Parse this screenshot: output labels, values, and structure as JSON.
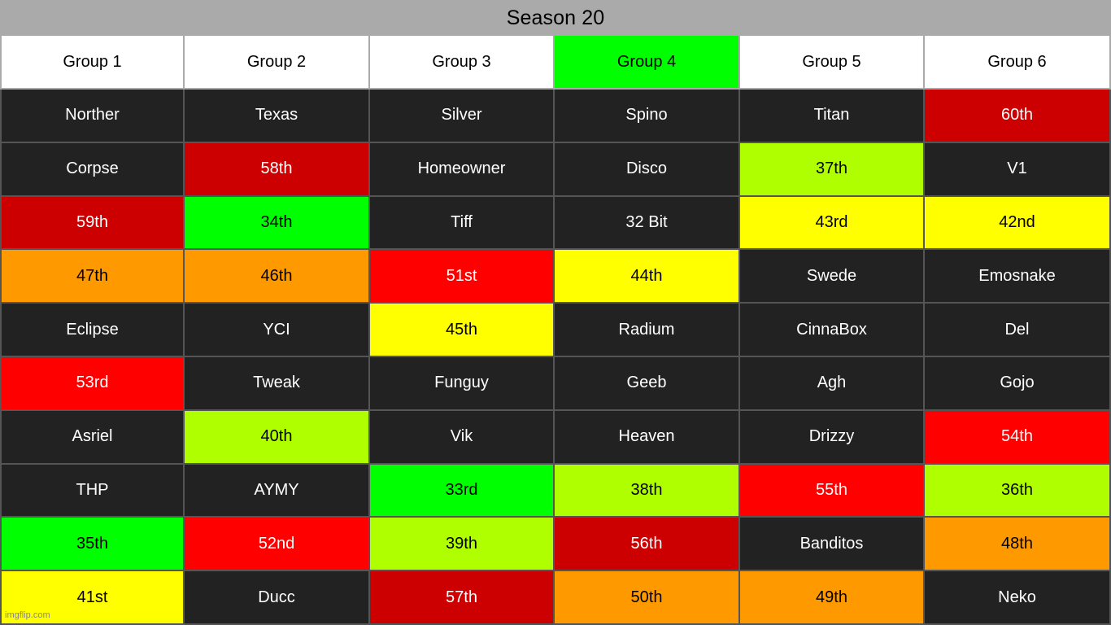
{
  "title": {
    "text": "Season 20",
    "bar_color": "#AAAAAA",
    "text_color": "#000000"
  },
  "watermark": {
    "text": "imgflip.com"
  },
  "palette": {
    "dark": "#222222",
    "green": "#00FF00",
    "lime": "#B0FF00",
    "yellow": "#FFFF00",
    "orange": "#FF9900",
    "red": "#FF0000",
    "darkred": "#CC0000",
    "white": "#FFFFFF",
    "border": "#555555",
    "header_border": "#AAAAAA"
  },
  "columns": [
    {
      "label": "Group 1",
      "state": "white"
    },
    {
      "label": "Group 2",
      "state": "white"
    },
    {
      "label": "Group 3",
      "state": "white"
    },
    {
      "label": "Group 4",
      "state": "green"
    },
    {
      "label": "Group 5",
      "state": "white"
    },
    {
      "label": "Group 6",
      "state": "white"
    }
  ],
  "rows": [
    [
      {
        "label": "Norther",
        "state": "dark"
      },
      {
        "label": "Texas",
        "state": "dark"
      },
      {
        "label": "Silver",
        "state": "dark"
      },
      {
        "label": "Spino",
        "state": "dark"
      },
      {
        "label": "Titan",
        "state": "dark"
      },
      {
        "label": "60th",
        "state": "darkred"
      }
    ],
    [
      {
        "label": "Corpse",
        "state": "dark"
      },
      {
        "label": "58th",
        "state": "darkred"
      },
      {
        "label": "Homeowner",
        "state": "dark"
      },
      {
        "label": "Disco",
        "state": "dark"
      },
      {
        "label": "37th",
        "state": "lime"
      },
      {
        "label": "V1",
        "state": "dark"
      }
    ],
    [
      {
        "label": "59th",
        "state": "darkred"
      },
      {
        "label": "34th",
        "state": "green"
      },
      {
        "label": "Tiff",
        "state": "dark"
      },
      {
        "label": "32 Bit",
        "state": "dark"
      },
      {
        "label": "43rd",
        "state": "yellow"
      },
      {
        "label": "42nd",
        "state": "yellow"
      }
    ],
    [
      {
        "label": "47th",
        "state": "orange"
      },
      {
        "label": "46th",
        "state": "orange"
      },
      {
        "label": "51st",
        "state": "red"
      },
      {
        "label": "44th",
        "state": "yellow"
      },
      {
        "label": "Swede",
        "state": "dark"
      },
      {
        "label": "Emosnake",
        "state": "dark"
      }
    ],
    [
      {
        "label": "Eclipse",
        "state": "dark"
      },
      {
        "label": "YCI",
        "state": "dark"
      },
      {
        "label": "45th",
        "state": "yellow"
      },
      {
        "label": "Radium",
        "state": "dark"
      },
      {
        "label": "CinnaBox",
        "state": "dark"
      },
      {
        "label": "Del",
        "state": "dark"
      }
    ],
    [
      {
        "label": "53rd",
        "state": "red"
      },
      {
        "label": "Tweak",
        "state": "dark"
      },
      {
        "label": "Funguy",
        "state": "dark"
      },
      {
        "label": "Geeb",
        "state": "dark"
      },
      {
        "label": "Agh",
        "state": "dark"
      },
      {
        "label": "Gojo",
        "state": "dark"
      }
    ],
    [
      {
        "label": "Asriel",
        "state": "dark"
      },
      {
        "label": "40th",
        "state": "lime"
      },
      {
        "label": "Vik",
        "state": "dark"
      },
      {
        "label": "Heaven",
        "state": "dark"
      },
      {
        "label": "Drizzy",
        "state": "dark"
      },
      {
        "label": "54th",
        "state": "red"
      }
    ],
    [
      {
        "label": "THP",
        "state": "dark"
      },
      {
        "label": "AYMY",
        "state": "dark"
      },
      {
        "label": "33rd",
        "state": "green"
      },
      {
        "label": "38th",
        "state": "lime"
      },
      {
        "label": "55th",
        "state": "red"
      },
      {
        "label": "36th",
        "state": "lime"
      }
    ],
    [
      {
        "label": "35th",
        "state": "green"
      },
      {
        "label": "52nd",
        "state": "red"
      },
      {
        "label": "39th",
        "state": "lime"
      },
      {
        "label": "56th",
        "state": "darkred"
      },
      {
        "label": "Banditos",
        "state": "dark"
      },
      {
        "label": "48th",
        "state": "orange"
      }
    ],
    [
      {
        "label": "41st",
        "state": "yellow"
      },
      {
        "label": "Ducc",
        "state": "dark"
      },
      {
        "label": "57th",
        "state": "darkred"
      },
      {
        "label": "50th",
        "state": "orange"
      },
      {
        "label": "49th",
        "state": "orange"
      },
      {
        "label": "Neko",
        "state": "dark"
      }
    ]
  ]
}
